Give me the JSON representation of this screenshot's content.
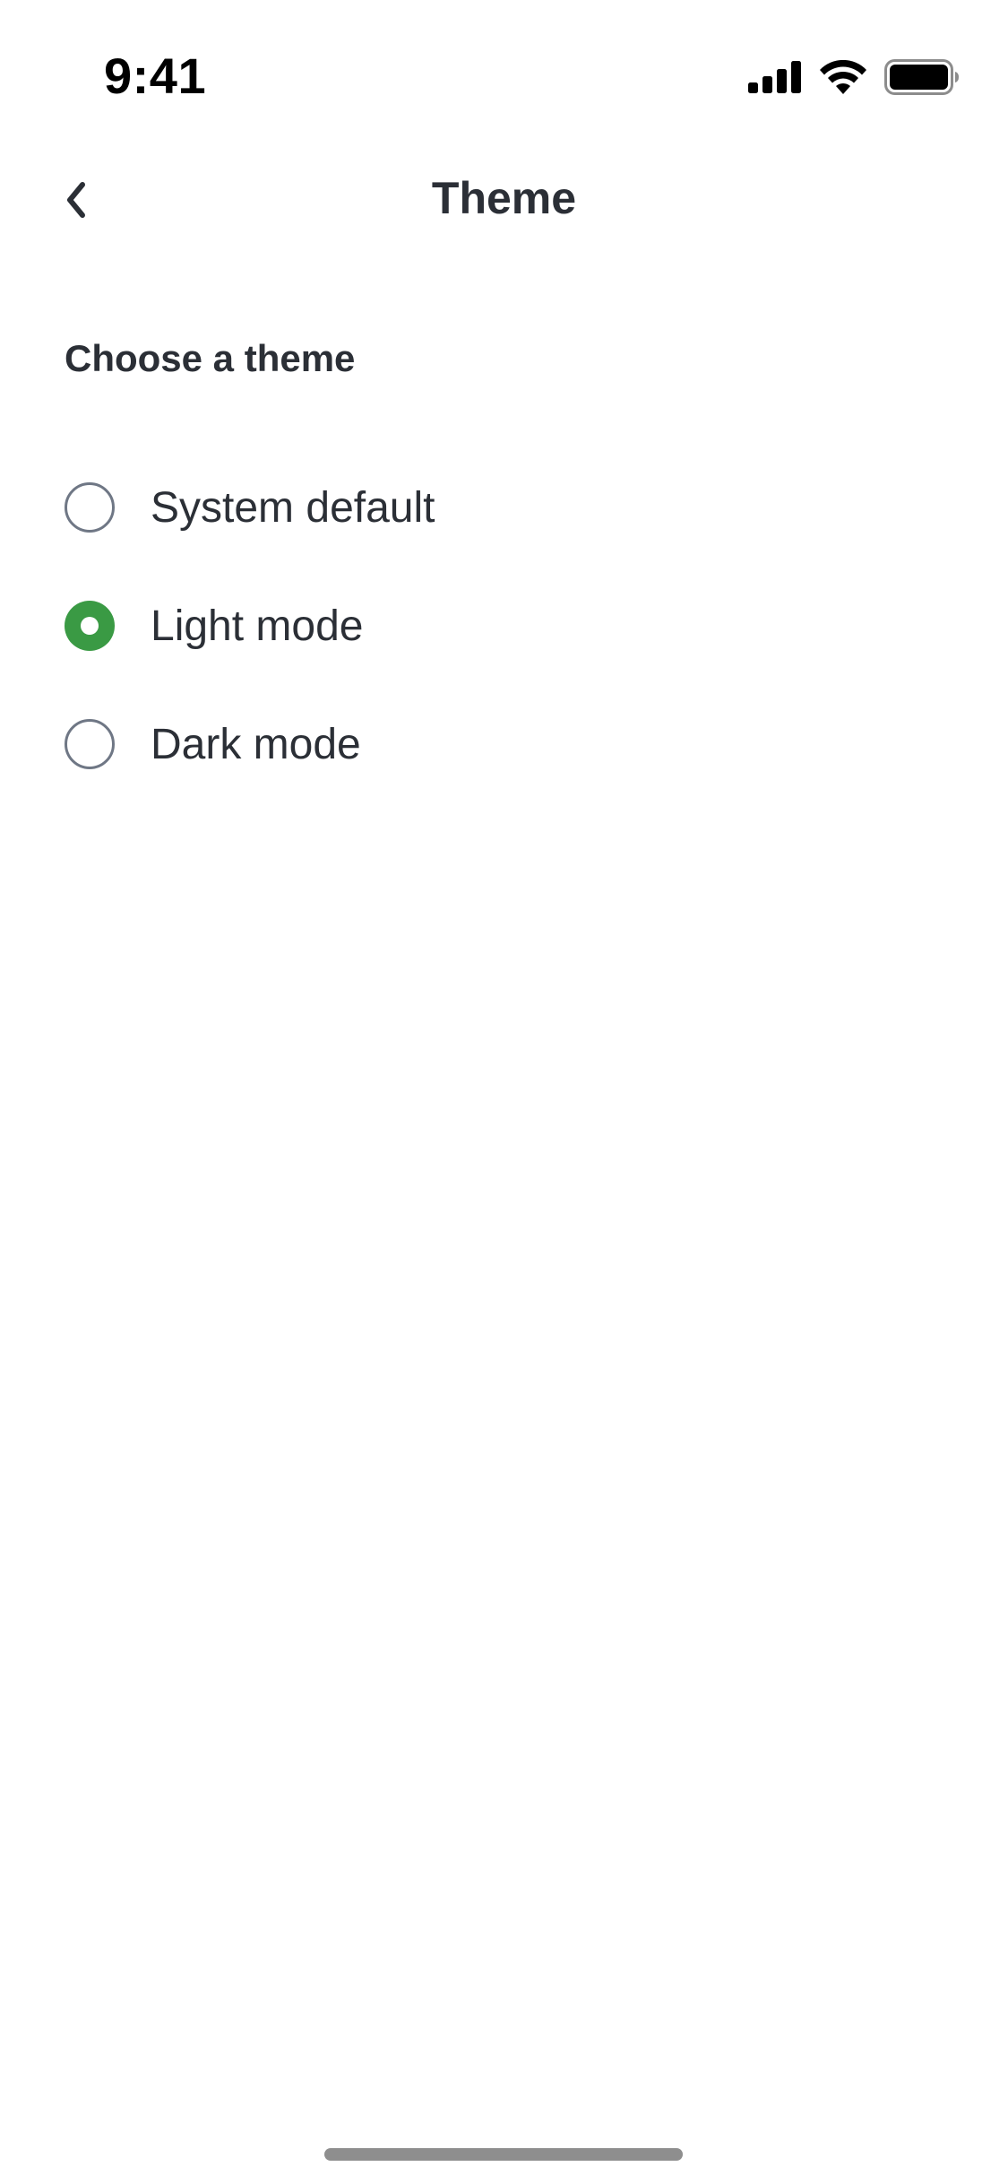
{
  "status_bar": {
    "time": "9:41",
    "icons": [
      "cellular-signal-icon",
      "wifi-icon",
      "battery-icon"
    ]
  },
  "nav": {
    "back_icon": "chevron-left-icon",
    "title": "Theme"
  },
  "section": {
    "title": "Choose a theme"
  },
  "options": [
    {
      "label": "System default",
      "selected": false
    },
    {
      "label": "Light mode",
      "selected": true
    },
    {
      "label": "Dark mode",
      "selected": false
    }
  ],
  "colors": {
    "accent": "#3a9a44",
    "text": "#2b2f36",
    "radio_border": "#6f7785",
    "background": "#ffffff"
  }
}
